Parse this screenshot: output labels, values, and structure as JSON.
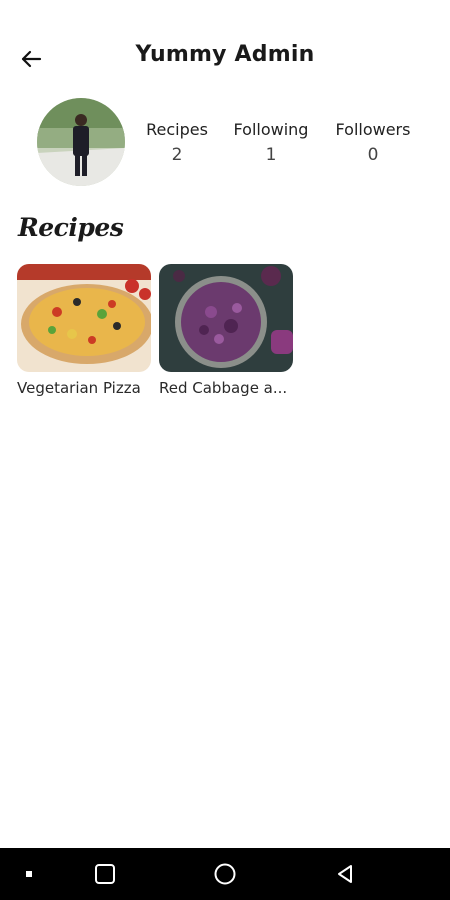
{
  "header": {
    "title": "Yummy Admin",
    "back_icon": "arrow-left-icon"
  },
  "profile": {
    "avatar_icon": "profile-photo",
    "stats": [
      {
        "label": "Recipes",
        "value": "2"
      },
      {
        "label": "Following",
        "value": "1"
      },
      {
        "label": "Followers",
        "value": "0"
      }
    ]
  },
  "recipes_section": {
    "title": "Recipes",
    "items": [
      {
        "name": "Vegetarian Pizza"
      },
      {
        "name": "Red Cabbage a..."
      }
    ]
  },
  "system_nav": {
    "icons": [
      "dot-icon",
      "square-icon",
      "circle-icon",
      "triangle-back-icon"
    ],
    "color": "#000000"
  }
}
